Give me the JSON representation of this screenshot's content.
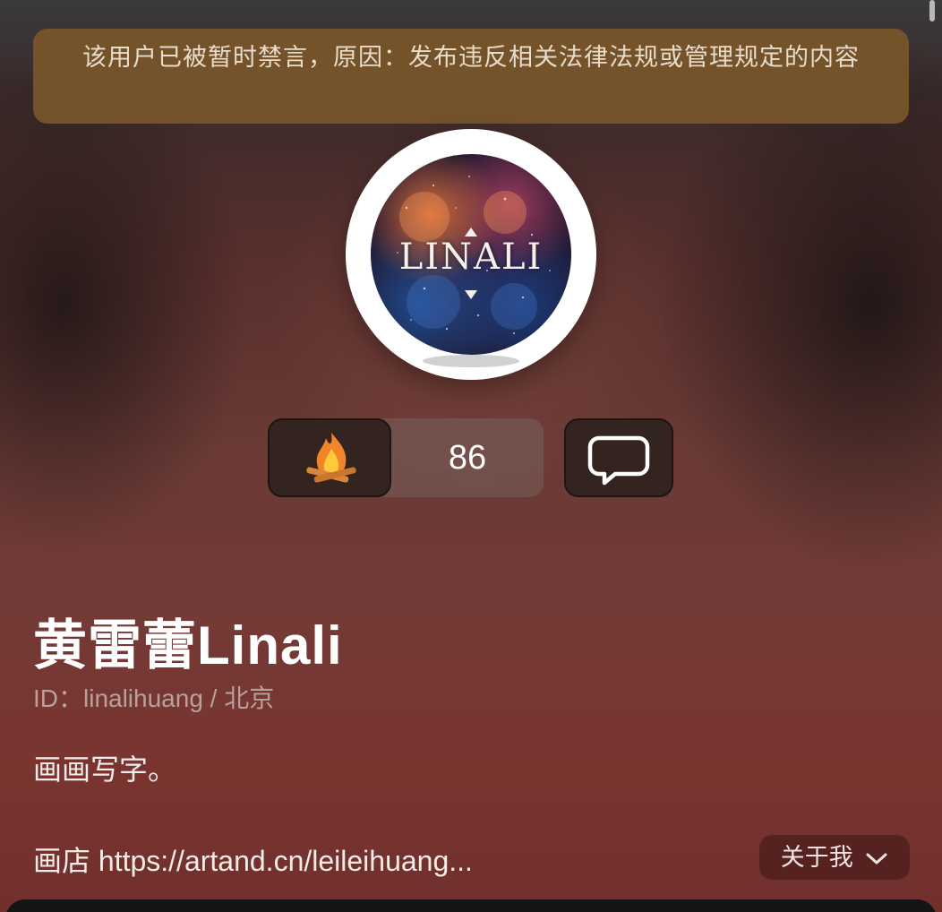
{
  "banner": {
    "text": "该用户已被暂时禁言，原因：发布违反相关法律法规或管理规定的内容"
  },
  "avatar": {
    "logo_text": "LINALI"
  },
  "stats": {
    "hot_count": "86",
    "hot_icon": "campfire-icon",
    "comment_icon": "speech-bubble-icon"
  },
  "profile": {
    "name": "黄雷蕾Linali",
    "id_line": "ID：linalihuang / 北京",
    "bio": "画画写字。",
    "link_line": "画店 https://artand.cn/leileihuang..."
  },
  "about_button": {
    "label": "关于我",
    "icon": "chevron-down-icon"
  },
  "colors": {
    "banner_bg": "#74532a",
    "button_bg": "#33241f"
  }
}
